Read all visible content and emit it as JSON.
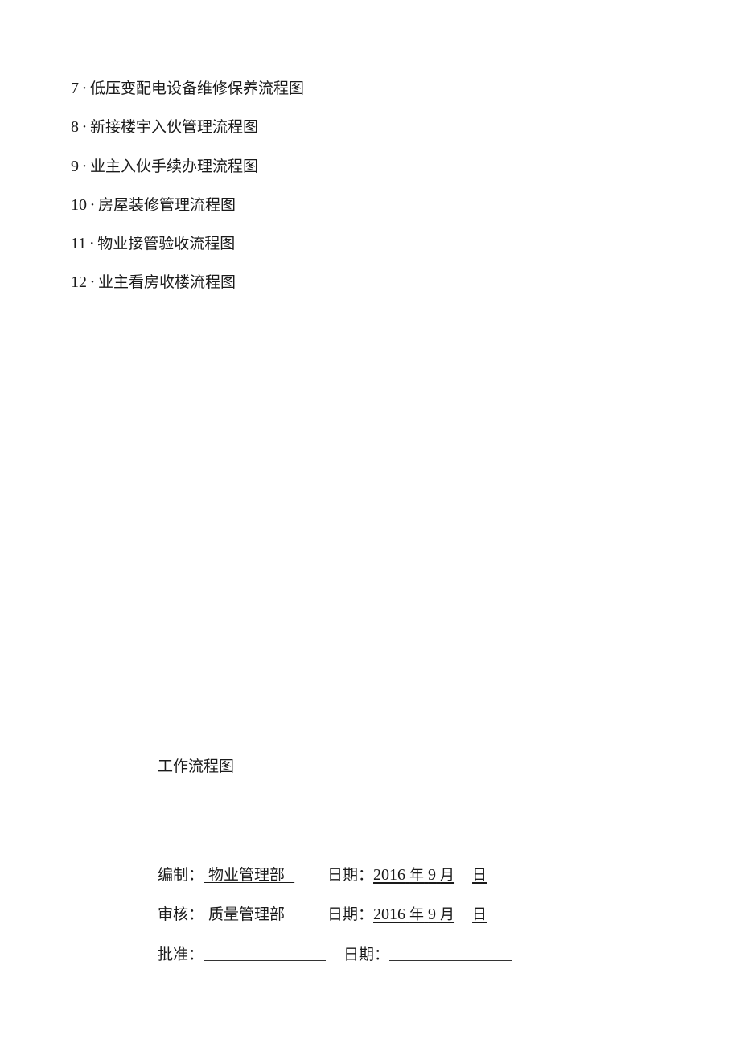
{
  "toc": {
    "items": [
      {
        "number": "7",
        "separator": "·",
        "title": "低压变配电设备维修保养流程图"
      },
      {
        "number": "8",
        "separator": "·",
        "title": "新接楼宇入伙管理流程图"
      },
      {
        "number": "9",
        "separator": "·",
        "title": "业主入伙手续办理流程图"
      },
      {
        "number": "10",
        "separator": "·",
        "title": "房屋装修管理流程图"
      },
      {
        "number": "11",
        "separator": "·",
        "title": "物业接管验收流程图"
      },
      {
        "number": "12",
        "separator": "·",
        "title": "业主看房收楼流程图"
      }
    ]
  },
  "cover": {
    "title": "工作流程图"
  },
  "signoff": {
    "prepared": {
      "label": "编制：",
      "value": " 物业管理部  ",
      "date_label": "日期：",
      "date_year": "2016",
      "date_year_unit": "年",
      "date_month": "9",
      "date_month_unit": "月",
      "date_day": "",
      "date_day_unit": "日"
    },
    "reviewed": {
      "label": "审核：",
      "value": " 质量管理部  ",
      "date_label": "日期：",
      "date_year": "2016",
      "date_year_unit": "年",
      "date_month": "9",
      "date_month_unit": "月",
      "date_day": "",
      "date_day_unit": "日"
    },
    "approved": {
      "label": "批准：",
      "value": "",
      "date_label": "日期：",
      "date_value": ""
    }
  }
}
